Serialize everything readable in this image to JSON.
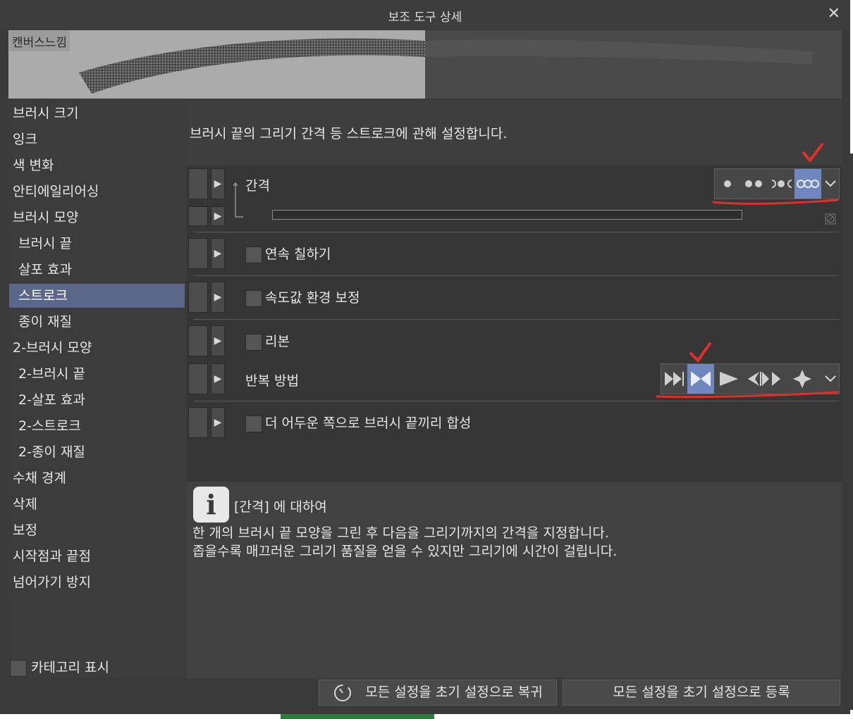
{
  "window": {
    "title": "보조 도구 상세",
    "close_symbol": "✕"
  },
  "preview": {
    "label": "캔버스느낌"
  },
  "sidebar": {
    "items": [
      {
        "label": "브러시 크기",
        "level": 0
      },
      {
        "label": "잉크",
        "level": 0
      },
      {
        "label": "색 변화",
        "level": 0
      },
      {
        "label": "안티에일리어싱",
        "level": 0
      },
      {
        "label": "브러시 모양",
        "level": 0
      },
      {
        "label": "브러시 끝",
        "level": 1
      },
      {
        "label": "살포 효과",
        "level": 1
      },
      {
        "label": "스트로크",
        "level": 1,
        "selected": true
      },
      {
        "label": "종이 재질",
        "level": 1
      },
      {
        "label": "2-브러시 모양",
        "level": 0
      },
      {
        "label": "2-브러시 끝",
        "level": 1
      },
      {
        "label": "2-살포 효과",
        "level": 1
      },
      {
        "label": "2-스트로크",
        "level": 1
      },
      {
        "label": "2-종이 재질",
        "level": 1
      },
      {
        "label": "수채 경계",
        "level": 0
      },
      {
        "label": "삭제",
        "level": 0
      },
      {
        "label": "보정",
        "level": 0
      },
      {
        "label": "시작점과 끝점",
        "level": 0
      },
      {
        "label": "넘어가기 방지",
        "level": 0
      }
    ],
    "show_category_label": "카테고리 표시"
  },
  "main": {
    "description": "브러시 끝의 그리기 간격 등 스트로크에 관해 설정합니다.",
    "spacing": {
      "label": "간격",
      "selected_index": 3,
      "options": [
        "single-dot-icon",
        "double-dot-icon",
        "half-dot-icon",
        "triple-dot-icon"
      ]
    },
    "continuous_label": "연속 칠하기",
    "speed_label": "속도값 환경 보정",
    "ribbon_label": "리본",
    "repeat": {
      "label": "반복 방법",
      "selected_index": 1,
      "options": [
        "repeat-forward-icon",
        "repeat-mirror-icon",
        "repeat-once-icon",
        "repeat-reverse-icon",
        "repeat-star-icon"
      ]
    },
    "blend_label": "더 어두운 쪽으로 브러시 끝끼리 합성"
  },
  "info": {
    "title": "[간격] 에 대하여",
    "line1": "한 개의 브러시 끝 모양을 그린 후 다음을 그리기까지의 간격을 지정합니다.",
    "line2": "좁을수록 매끄러운 그리기 품질을 얻을 수 있지만 그리기에 시간이 걸립니다."
  },
  "footer": {
    "reset_label": "모든 설정을 초기 설정으로 복귀",
    "register_label": "모든 설정을 초기 설정으로 등록"
  },
  "colors": {
    "selected_bg": "#5a6788",
    "active_option": "#6f86bf",
    "annotation_red": "#e0302b"
  }
}
